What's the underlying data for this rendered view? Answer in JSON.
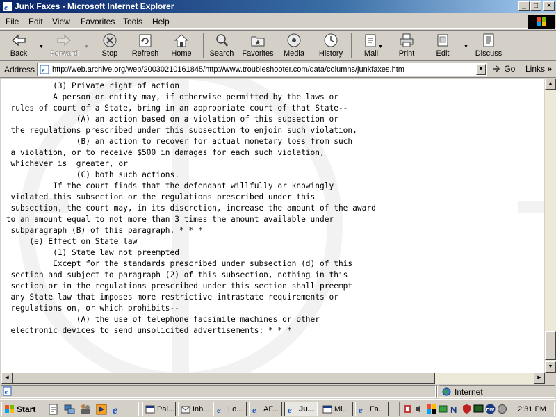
{
  "window": {
    "title": "Junk Faxes - Microsoft Internet Explorer",
    "controls": {
      "minimize": "_",
      "maximize": "□",
      "close": "×"
    }
  },
  "menu": [
    "File",
    "Edit",
    "View",
    "Favorites",
    "Tools",
    "Help"
  ],
  "toolbar": {
    "back": "Back",
    "forward": "Forward",
    "stop": "Stop",
    "refresh": "Refresh",
    "home": "Home",
    "search": "Search",
    "favorites": "Favorites",
    "media": "Media",
    "history": "History",
    "mail": "Mail",
    "print": "Print",
    "edit": "Edit",
    "discuss": "Discuss"
  },
  "address": {
    "label": "Address",
    "url": "http://web.archive.org/web/20030210161845/http://www.troubleshooter.com/data/columns/junkfaxes.htm",
    "go": "Go",
    "links": "Links"
  },
  "document": {
    "lines": [
      "           (3) Private right of action",
      "           A person or entity may, if otherwise permitted by the laws or",
      "  rules of court of a State, bring in an appropriate court of that State--",
      "                (A) an action based on a violation of this subsection or",
      "  the regulations prescribed under this subsection to enjoin such violation,",
      "                (B) an action to recover for actual monetary loss from such",
      "  a violation, or to receive $500 in damages for each such violation,",
      "  whichever is  greater, or",
      "                (C) both such actions.",
      "           If the court finds that the defendant willfully or knowingly",
      "  violated this subsection or the regulations prescribed under this",
      "  subsection, the court may, in its discretion, increase the amount of the award",
      " to an amount equal to not more than 3 times the amount available under",
      "  subparagraph (B) of this paragraph. * * *",
      "      (e) Effect on State law",
      "           (1) State law not preempted",
      "           Except for the standards prescribed under subsection (d) of this",
      "  section and subject to paragraph (2) of this subsection, nothing in this",
      "  section or in the regulations prescribed under this section shall preempt",
      "  any State law that imposes more restrictive intrastate requirements or",
      "  regulations on, or which prohibits--",
      "                (A) the use of telephone facsimile machines or other",
      "  electronic devices to send unsolicited advertisements; * * *"
    ]
  },
  "status": {
    "zone": "Internet"
  },
  "taskbar": {
    "start": "Start",
    "tasks": [
      {
        "label": "Pal...",
        "active": false
      },
      {
        "label": "Inb...",
        "active": false
      },
      {
        "label": "Lo...",
        "active": false
      },
      {
        "label": "AF...",
        "active": false
      },
      {
        "label": "Ju...",
        "active": true
      },
      {
        "label": "Mi...",
        "active": false
      },
      {
        "label": "Fa...",
        "active": false
      }
    ],
    "clock": "2:31 PM"
  },
  "colors": {
    "titlebar_start": "#0a246a",
    "titlebar_end": "#a6caf0",
    "chrome": "#d4d0c8"
  }
}
